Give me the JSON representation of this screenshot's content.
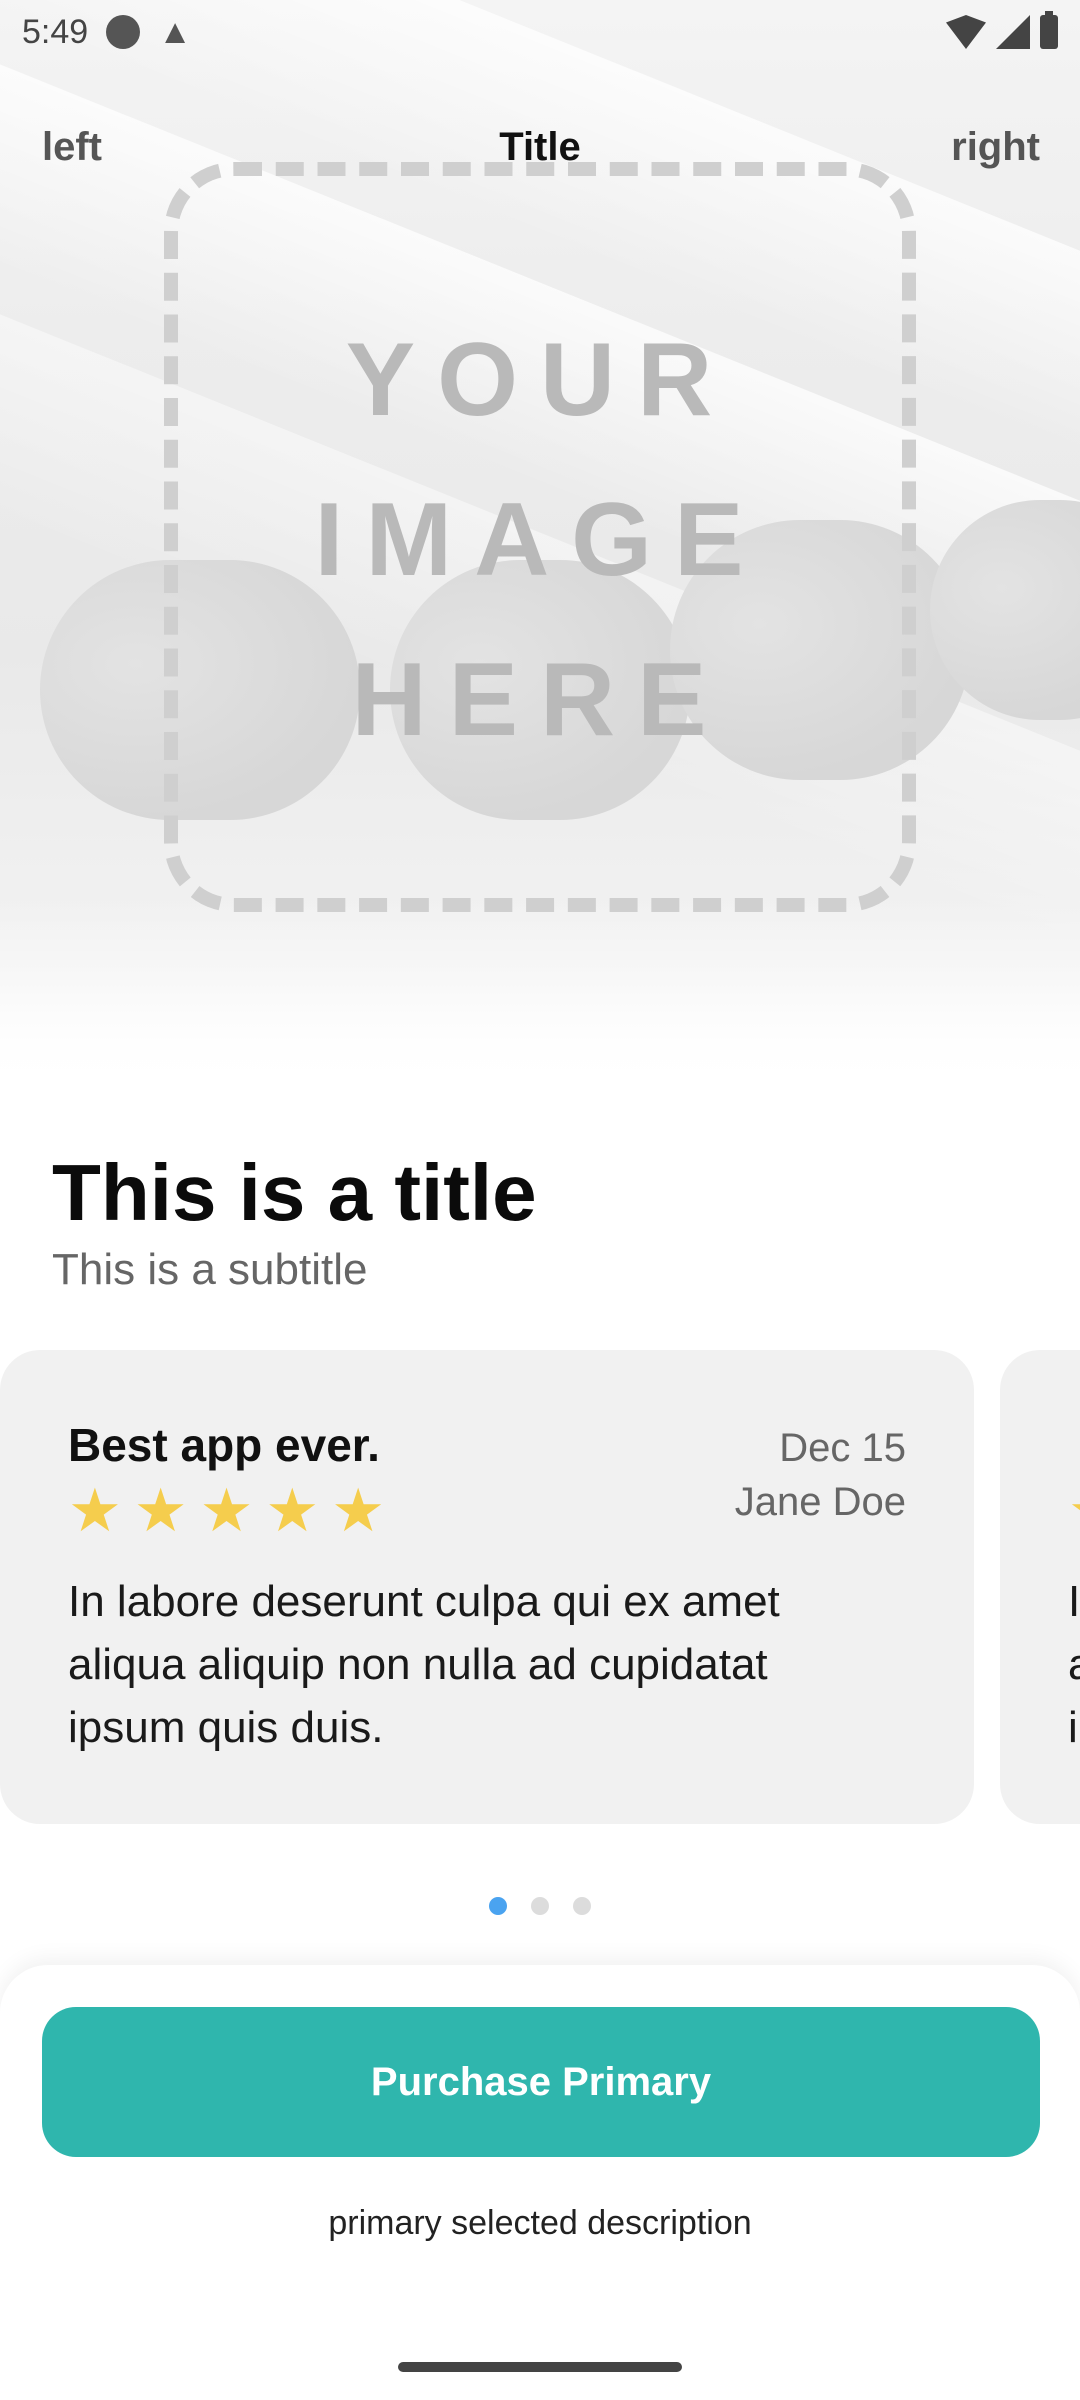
{
  "status_bar": {
    "time": "5:49",
    "icons": [
      "record-dot-icon",
      "warning-icon",
      "wifi-icon",
      "signal-icon",
      "battery-icon"
    ]
  },
  "nav": {
    "left_label": "left",
    "title": "Title",
    "right_label": "right"
  },
  "hero": {
    "placeholder_lines": [
      "YOUR",
      "IMAGE",
      "HERE"
    ]
  },
  "content": {
    "title": "This is a title",
    "subtitle": "This is a subtitle"
  },
  "reviews": [
    {
      "title": "Best app ever.",
      "date": "Dec 15",
      "author": "Jane Doe",
      "rating": 5,
      "body": "In labore deserunt culpa qui ex amet aliqua aliquip non nulla ad cupidatat ipsum quis duis."
    },
    {
      "title": "B",
      "rating": 5,
      "body": "I a i"
    }
  ],
  "pager": {
    "count": 3,
    "active_index": 0
  },
  "purchase": {
    "button_label": "Purchase Primary",
    "description": "primary selected description"
  },
  "colors": {
    "accent": "#2fb6ad",
    "star": "#f5cd4d",
    "pager_active": "#4aa3f0",
    "card_bg": "#f1f1f1"
  }
}
